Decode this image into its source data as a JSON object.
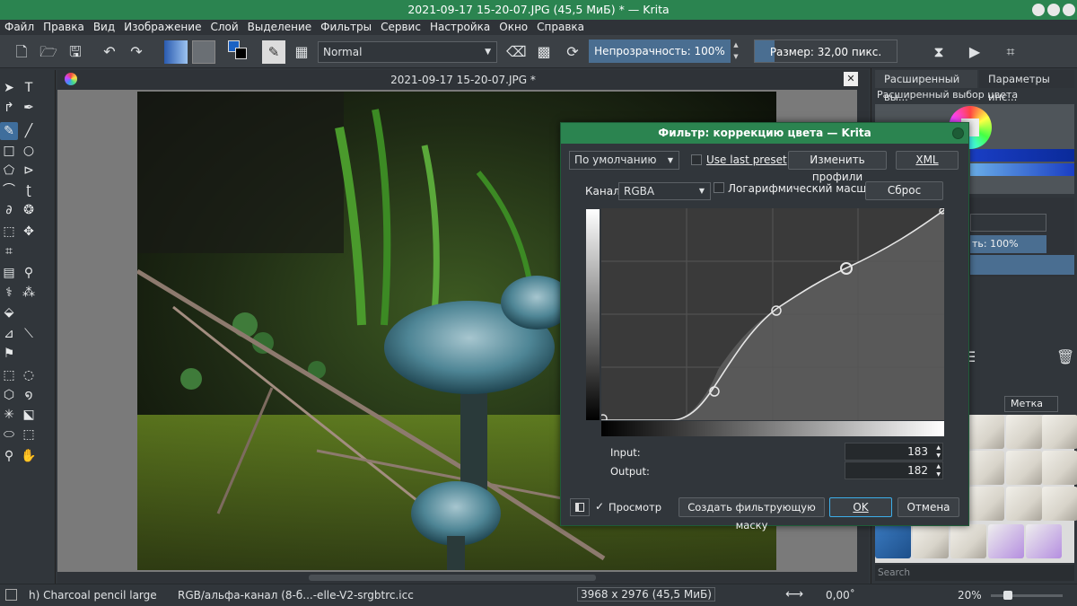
{
  "window": {
    "title": "2021-09-17 15-20-07.JPG (45,5 МиБ)  * — Krita"
  },
  "menu": [
    "Файл",
    "Правка",
    "Вид",
    "Изображение",
    "Слой",
    "Выделение",
    "Фильтры",
    "Сервис",
    "Настройка",
    "Окно",
    "Справка"
  ],
  "toolbar": {
    "blend_mode": "Normal",
    "opacity": "Непрозрачность: 100%",
    "size": "Размер: 32,00 пикс."
  },
  "document": {
    "tab_title": "2021-09-17 15-20-07.JPG *"
  },
  "dock": {
    "tab1": "Расширенный вы...",
    "tab2": "Параметры инс...",
    "color_title": "Расширенный выбор цвета",
    "layer_opacity": "ть: 100%",
    "tag_label": "Метка",
    "search_placeholder": "Search"
  },
  "dialog": {
    "title": "Фильтр: коррекцию цвета — Krita",
    "preset": "По умолчанию",
    "use_last_preset": "Use last preset",
    "edit_profiles": "Изменить профили",
    "xml": "XML",
    "channel_label": "Канал:",
    "channel_value": "RGBA",
    "log_scale": "Логарифмический масштаб",
    "reset": "Сброс",
    "input_label": "Input:",
    "input_value": "183",
    "output_label": "Output:",
    "output_value": "182",
    "preview_label": "Просмотр",
    "create_mask": "Создать фильтрующую маску",
    "ok": "OK",
    "cancel": "Отмена"
  },
  "status": {
    "brush": "h) Charcoal pencil large",
    "colorspace": "RGB/альфа-канал (8-б...-elle-V2-srgbtrc.icc",
    "dimensions": "3968 x 2976 (45,5 МиБ)",
    "rotation": "0,00˚",
    "zoom": "20%"
  },
  "colors": {
    "accent": "#2b8450",
    "selection": "#3daee9",
    "panel": "#31363b"
  }
}
